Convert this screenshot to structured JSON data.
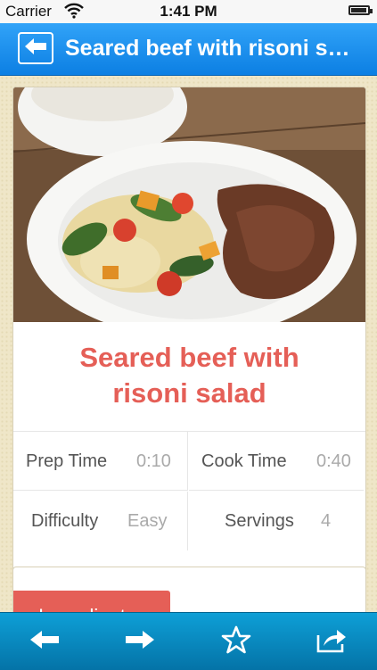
{
  "status_bar": {
    "carrier": "Carrier",
    "time": "1:41 PM"
  },
  "nav": {
    "title": "Seared beef with risoni salad"
  },
  "recipe": {
    "title_line1": "Seared beef with",
    "title_line2": "risoni salad",
    "prep_time_label": "Prep Time",
    "prep_time_value": "0:10",
    "cook_time_label": "Cook Time",
    "cook_time_value": "0:40",
    "difficulty_label": "Difficulty",
    "difficulty_value": "Easy",
    "servings_label": "Servings",
    "servings_value": "4"
  },
  "ingredients_tab": {
    "label": "Ingredients"
  },
  "toolbar": {
    "icons": [
      "back-arrow-icon",
      "forward-arrow-icon",
      "star-icon",
      "share-icon"
    ]
  },
  "colors": {
    "nav_blue": "#1b8ff0",
    "toolbar_blue": "#0a8cc4",
    "accent_red": "#e55f57",
    "page_bg": "#efe6c8"
  }
}
